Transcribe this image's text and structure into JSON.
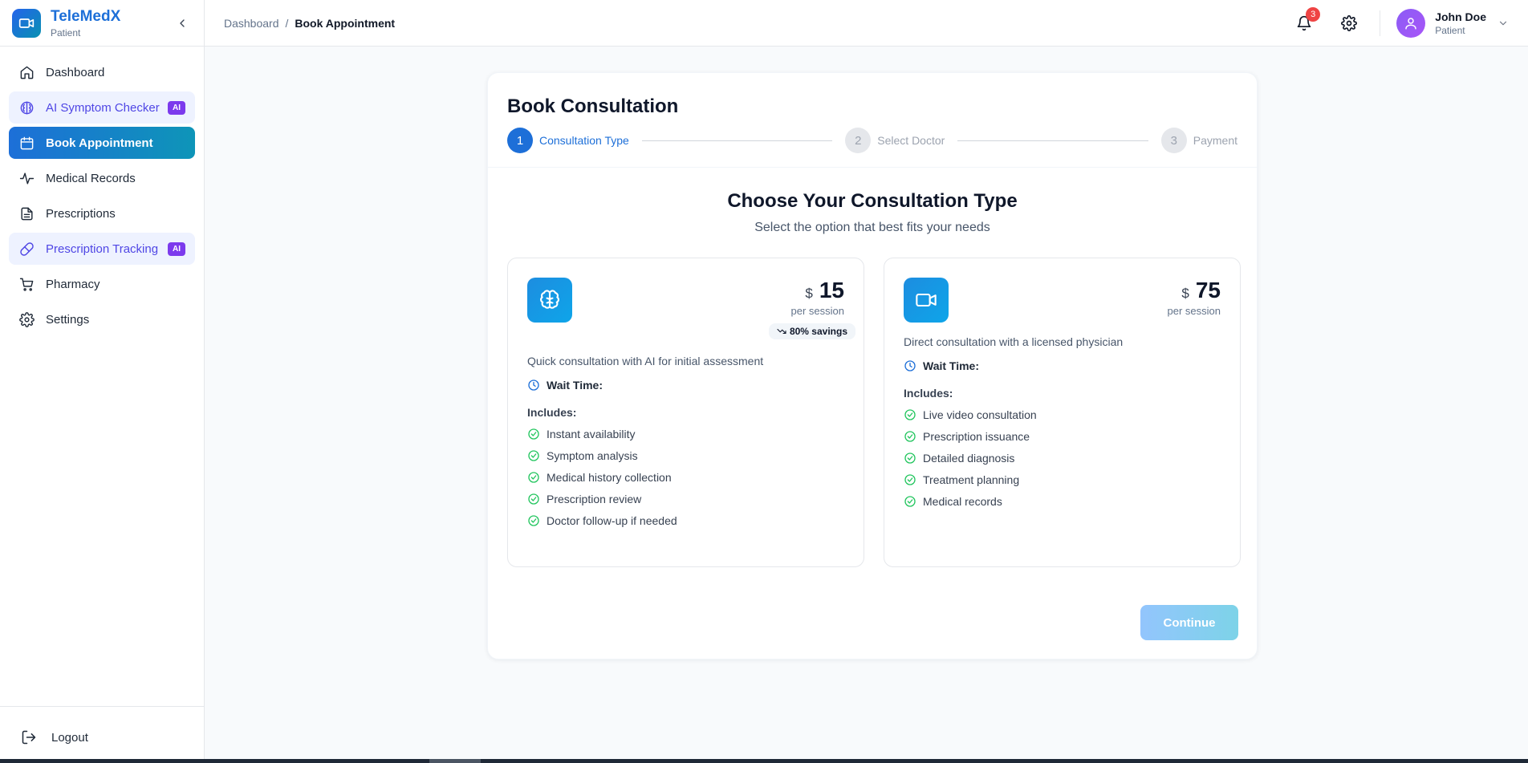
{
  "app": {
    "name": "TeleMedX",
    "role": "Patient"
  },
  "sidebar": {
    "items": [
      {
        "label": "Dashboard",
        "icon": "home-icon"
      },
      {
        "label": "AI Symptom Checker",
        "icon": "brain-icon",
        "badge": "AI"
      },
      {
        "label": "Book Appointment",
        "icon": "calendar-icon"
      },
      {
        "label": "Medical Records",
        "icon": "activity-icon"
      },
      {
        "label": "Prescriptions",
        "icon": "document-icon"
      },
      {
        "label": "Prescription Tracking",
        "icon": "pill-icon",
        "badge": "AI"
      },
      {
        "label": "Pharmacy",
        "icon": "cart-icon"
      },
      {
        "label": "Settings",
        "icon": "gear-icon"
      }
    ],
    "logout_label": "Logout"
  },
  "topbar": {
    "breadcrumb": [
      "Dashboard",
      "/",
      "Book Appointment"
    ],
    "notification_count": "3",
    "user": {
      "name": "John Doe",
      "role": "Patient"
    }
  },
  "booking": {
    "title": "Book Consultation",
    "steps": [
      {
        "number": "1",
        "label": "Consultation Type",
        "state": "active"
      },
      {
        "number": "2",
        "label": "Select Doctor",
        "state": "inactive"
      },
      {
        "number": "3",
        "label": "Payment",
        "state": "inactive"
      }
    ],
    "heading": "Choose Your Consultation Type",
    "subheading": "Select the option that best fits your needs",
    "options": [
      {
        "icon": "brain-icon",
        "currency": "$",
        "price": "15",
        "per": "per session",
        "savings": "80% savings",
        "description": "Quick consultation with AI for initial assessment",
        "wait_label": "Wait Time:",
        "includes_label": "Includes:",
        "features": [
          "Instant availability",
          "Symptom analysis",
          "Medical history collection",
          "Prescription review",
          "Doctor follow-up if needed"
        ]
      },
      {
        "icon": "video-icon",
        "currency": "$",
        "price": "75",
        "per": "per session",
        "description": "Direct consultation with a licensed physician",
        "wait_label": "Wait Time:",
        "includes_label": "Includes:",
        "features": [
          "Live video consultation",
          "Prescription issuance",
          "Detailed diagnosis",
          "Treatment planning",
          "Medical records"
        ]
      }
    ],
    "continue_label": "Continue"
  },
  "colors": {
    "primary": "#1d6fd8",
    "ai_badge": "#7c3aed",
    "check": "#22c55e",
    "notification": "#ef4444"
  }
}
